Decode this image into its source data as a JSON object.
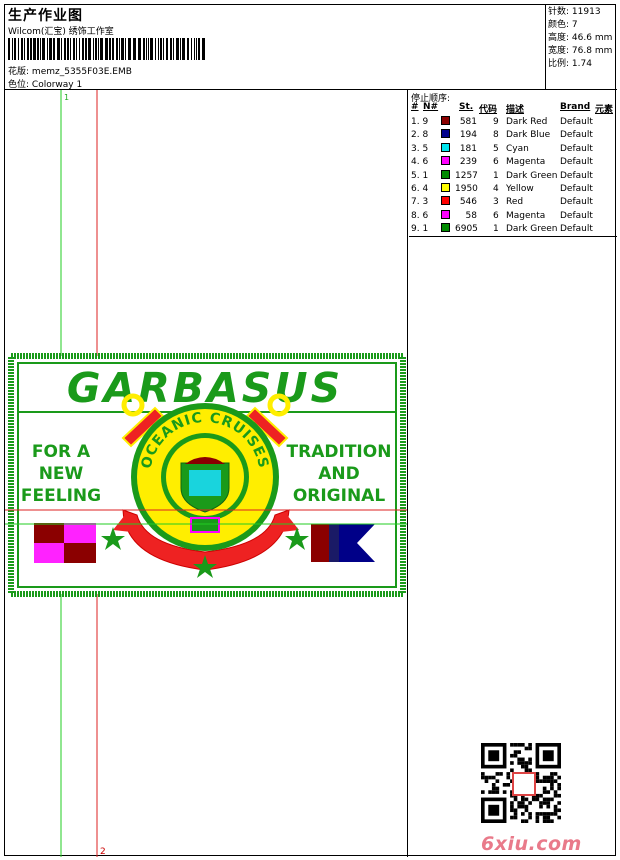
{
  "header": {
    "title": "生产作业图",
    "subtitle": "Wilcom(汇宝) 绣饰工作室",
    "design_label": "花版:",
    "design_value": "memz_5355F03E.EMB",
    "colorway_label": "色位:",
    "colorway_value": "Colorway 1"
  },
  "stats": [
    {
      "label": "针数:",
      "value": "11913"
    },
    {
      "label": "颜色:",
      "value": "7"
    },
    {
      "label": "高度:",
      "value": "46.6 mm"
    },
    {
      "label": "宽度:",
      "value": "76.8 mm"
    },
    {
      "label": "比例:",
      "value": "1.74"
    }
  ],
  "stop_sequence": {
    "title": "停止顺序:",
    "columns": [
      "#",
      "N#",
      "St.",
      "代码",
      "描述",
      "Brand",
      "元素"
    ],
    "rows": [
      {
        "num": "1. 9",
        "color": "#8B0000",
        "st": "581",
        "code": "9",
        "desc": "Dark Red",
        "brand": "Default"
      },
      {
        "num": "2. 8",
        "color": "#00008B",
        "st": "194",
        "code": "8",
        "desc": "Dark Blue",
        "brand": "Default"
      },
      {
        "num": "3. 5",
        "color": "#00E5EE",
        "st": "181",
        "code": "5",
        "desc": "Cyan",
        "brand": "Default"
      },
      {
        "num": "4. 6",
        "color": "#FF00FF",
        "st": "239",
        "code": "6",
        "desc": "Magenta",
        "brand": "Default"
      },
      {
        "num": "5. 1",
        "color": "#008B00",
        "st": "1257",
        "code": "1",
        "desc": "Dark Green",
        "brand": "Default"
      },
      {
        "num": "6. 4",
        "color": "#FFFF00",
        "st": "1950",
        "code": "4",
        "desc": "Yellow",
        "brand": "Default"
      },
      {
        "num": "7. 3",
        "color": "#FF0000",
        "st": "546",
        "code": "3",
        "desc": "Red",
        "brand": "Default"
      },
      {
        "num": "8. 6",
        "color": "#FF00FF",
        "st": "58",
        "code": "6",
        "desc": "Magenta",
        "brand": "Default"
      },
      {
        "num": "9. 1",
        "color": "#008B00",
        "st": "6905",
        "code": "1",
        "desc": "Dark Green",
        "brand": "Default"
      }
    ]
  },
  "canvas": {
    "guide_label_1": "1",
    "guide_label_2": "2",
    "design_text": {
      "brand": "GARBASUS",
      "left_lines": [
        "FOR A",
        "NEW",
        "FEELING"
      ],
      "right_lines": [
        "TRADITION",
        "AND",
        "ORIGINAL"
      ],
      "ring_text": "OCEANIC CRUISES"
    }
  },
  "watermark": "6xiu.com"
}
